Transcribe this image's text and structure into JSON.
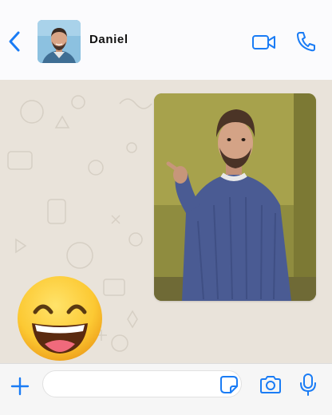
{
  "contact": {
    "name": "Daniel"
  },
  "header": {
    "icons": {
      "back": "chevron-left-icon",
      "video_call": "video-camera-icon",
      "voice_call": "phone-icon"
    }
  },
  "conversation": {
    "messages": [
      {
        "type": "media",
        "direction": "incoming",
        "content": "video-still"
      },
      {
        "type": "emoji",
        "direction": "incoming",
        "content": "😅"
      }
    ],
    "emoji": "😅"
  },
  "composer": {
    "input_value": "",
    "icons": {
      "attach": "plus-icon",
      "sticker": "sticker-icon",
      "camera": "camera-icon",
      "mic": "microphone-icon"
    }
  },
  "colors": {
    "accent": "#1a7cf5",
    "header_bg": "#fbfbfd",
    "chat_bg": "#e9e3da",
    "composer_bg": "#f6f6f6"
  }
}
